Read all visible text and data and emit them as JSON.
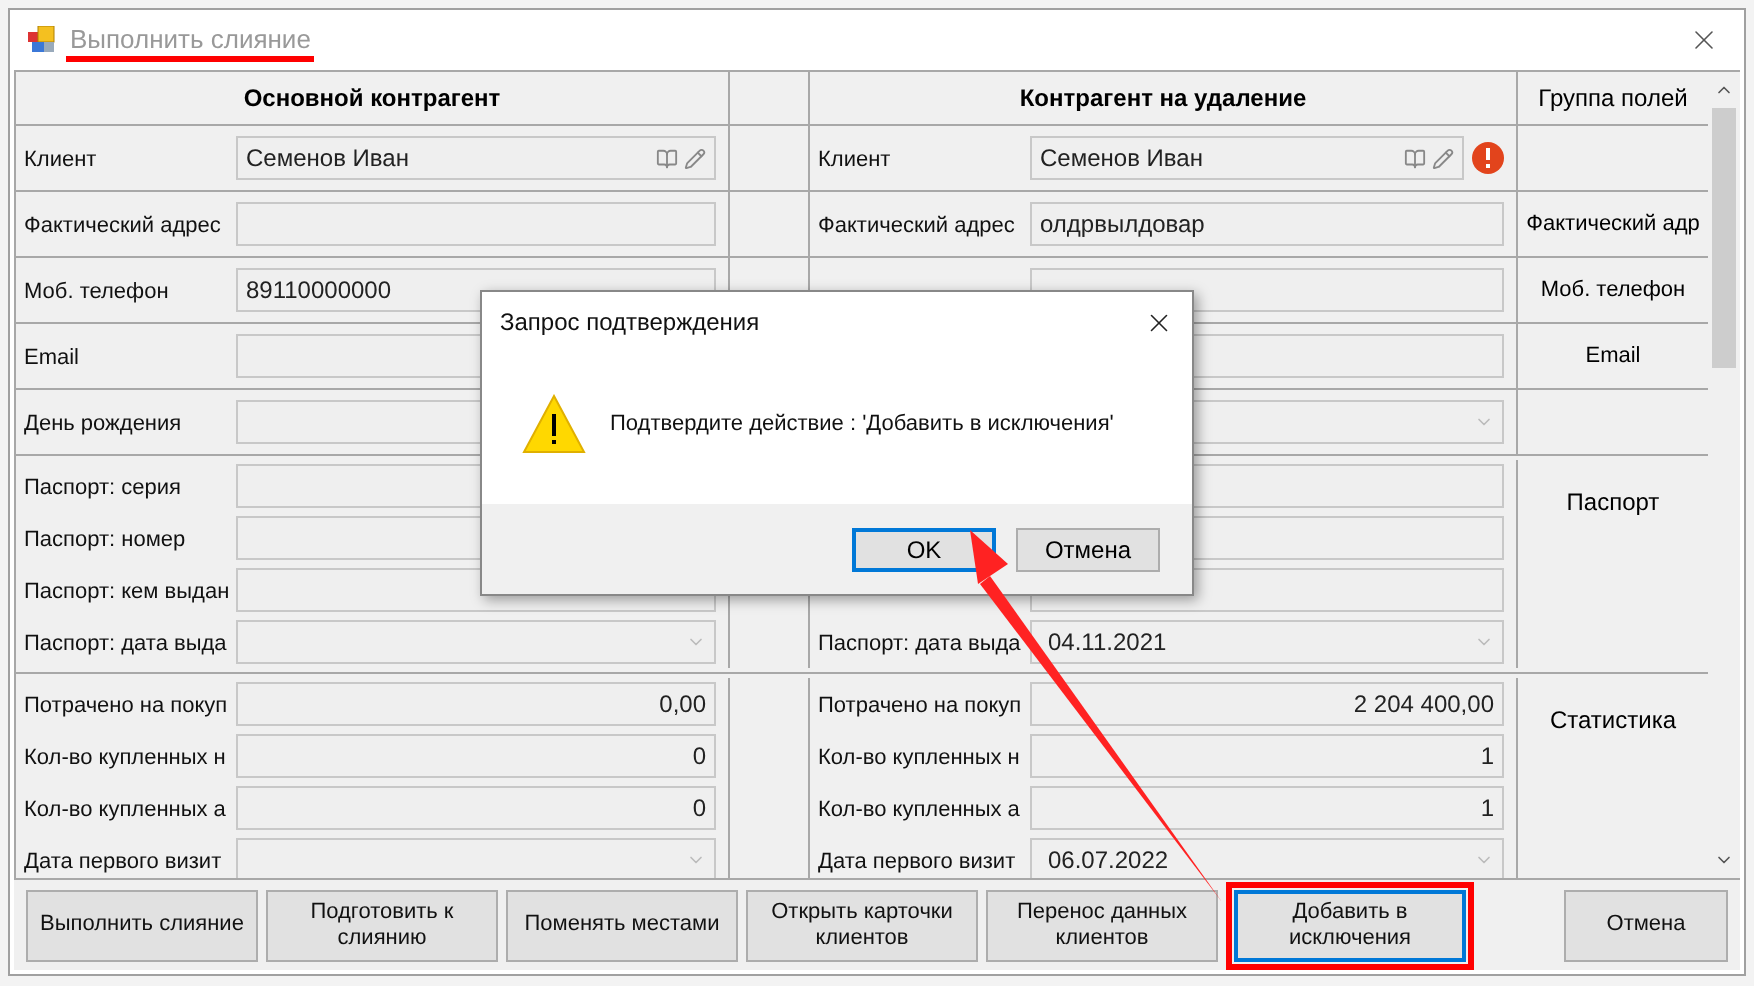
{
  "window": {
    "title": "Выполнить слияние",
    "title_underlined": true
  },
  "table": {
    "columns": [
      "Основной контрагент",
      "Контрагент на удаление",
      "Группа полей"
    ],
    "groups": [
      {
        "rows": [
          {
            "left": {
              "label": "Клиент",
              "kind": "lookup",
              "value": "Семенов Иван"
            },
            "right": {
              "label": "Клиент",
              "kind": "lookup",
              "value": "Семенов Иван",
              "error": true
            }
          }
        ]
      },
      {
        "group_label": "Фактический адр",
        "rows": [
          {
            "left": {
              "label": "Фактический адрес",
              "kind": "text"
            },
            "right": {
              "label": "Фактический адрес",
              "kind": "text",
              "value": "олдрвылдовар"
            }
          }
        ]
      },
      {
        "group_label": "Моб. телефон",
        "rows": [
          {
            "left": {
              "label": "Моб. телефон",
              "kind": "text",
              "value": "89110000000"
            },
            "right": {
              "kind": "text"
            }
          }
        ]
      },
      {
        "group_label": "Email",
        "rows": [
          {
            "left": {
              "label": "Email",
              "kind": "text"
            },
            "right": {
              "kind": "text"
            }
          }
        ]
      },
      {
        "rows": [
          {
            "left": {
              "label": "День рождения",
              "kind": "text"
            },
            "right": {
              "kind": "date"
            }
          }
        ]
      },
      {
        "group_label": "Паспорт",
        "rows": [
          {
            "left": {
              "label": "Паспорт: серия",
              "kind": "text"
            },
            "right": {
              "kind": "text"
            }
          },
          {
            "left": {
              "label": "Паспорт: номер",
              "kind": "text"
            },
            "right": {
              "kind": "text"
            }
          },
          {
            "left": {
              "label": "Паспорт: кем выдан",
              "kind": "text"
            },
            "right": {
              "kind": "text"
            }
          },
          {
            "left": {
              "label": "Паспорт: дата выда",
              "kind": "date"
            },
            "right": {
              "label": "Паспорт: дата выда",
              "kind": "date",
              "value": "04.11.2021"
            }
          }
        ]
      },
      {
        "group_label": "Статистика",
        "rows": [
          {
            "left": {
              "label": "Потрачено на покуп",
              "kind": "number",
              "value": "0,00"
            },
            "right": {
              "label": "Потрачено на покуп",
              "kind": "number",
              "value": "2 204 400,00"
            }
          },
          {
            "left": {
              "label": "Кол-во купленных н",
              "kind": "number",
              "value": "0"
            },
            "right": {
              "label": "Кол-во купленных н",
              "kind": "number",
              "value": "1"
            }
          },
          {
            "left": {
              "label": "Кол-во купленных а",
              "kind": "number",
              "value": "0"
            },
            "right": {
              "label": "Кол-во купленных а",
              "kind": "number",
              "value": "1"
            }
          },
          {
            "left": {
              "label": "Дата первого визит",
              "kind": "date"
            },
            "right": {
              "label": "Дата первого визит",
              "kind": "date",
              "value": "06.07.2022"
            }
          }
        ]
      }
    ]
  },
  "buttons": [
    {
      "label": "Выполнить слияние",
      "focused": false,
      "highlighted": false
    },
    {
      "label": "Подготовить к слиянию",
      "focused": false,
      "highlighted": false
    },
    {
      "label": "Поменять местами",
      "focused": false,
      "highlighted": false
    },
    {
      "label": "Открыть карточки клиентов",
      "focused": false,
      "highlighted": false
    },
    {
      "label": "Перенос данных клиентов",
      "focused": false,
      "highlighted": false
    },
    {
      "label": "Добавить в исключения",
      "focused": true,
      "highlighted": true
    },
    {
      "label": "Отмена",
      "focused": false,
      "highlighted": false,
      "kind": "cancel"
    }
  ],
  "dialog": {
    "title": "Запрос подтверждения",
    "message": "Подтвердите действие : 'Добавить в исключения'",
    "buttons": [
      {
        "label": "OK",
        "focused": true
      },
      {
        "label": "Отмена",
        "focused": false
      }
    ]
  },
  "annotations": [
    {
      "kind": "arrow"
    }
  ]
}
